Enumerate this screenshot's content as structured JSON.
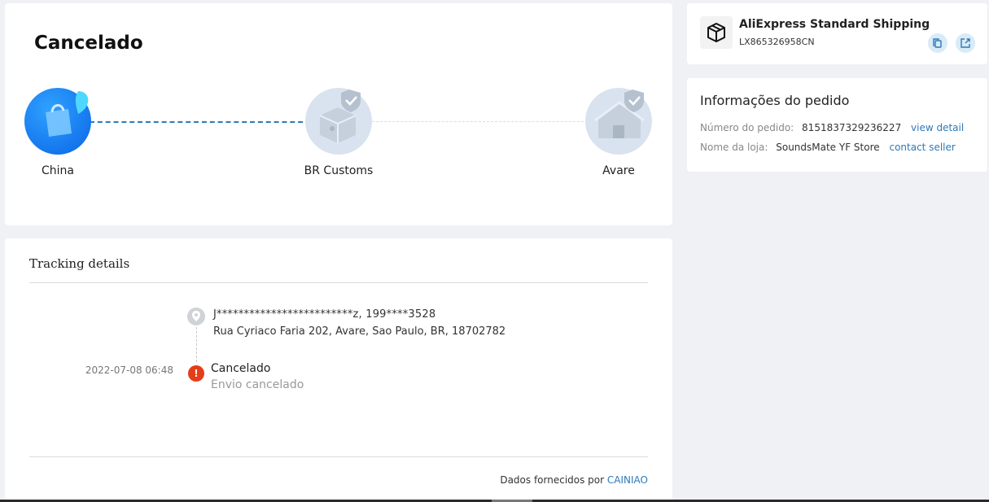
{
  "status": {
    "title": "Cancelado",
    "nodes": [
      {
        "label": "China",
        "state": "done",
        "icon": "shopping-bag-icon"
      },
      {
        "label": "BR Customs",
        "state": "pending",
        "icon": "customs-box-icon"
      },
      {
        "label": "Avare",
        "state": "pending",
        "icon": "house-icon"
      }
    ]
  },
  "tracking": {
    "title": "Tracking details",
    "recipient": "J*************************z,  199****3528",
    "address": "Rua Cyriaco Faria 202,  Avare,  Sao Paulo,  BR,  18702782",
    "event": {
      "time": "2022-07-08 06:48",
      "status": "Cancelado",
      "detail": "Envio cancelado"
    },
    "provider_prefix": "Dados fornecidos por",
    "provider_name": "CAINIAO"
  },
  "shipping": {
    "name": "AliExpress Standard Shipping",
    "number": "LX865326958CN"
  },
  "order": {
    "title": "Informações do pedido",
    "order_label": "Número do pedido:",
    "order_number": "8151837329236227",
    "order_link": "view detail",
    "store_label": "Nome da loja:",
    "store_name": "SoundsMate YF Store",
    "store_link": "contact seller"
  },
  "colors": {
    "accent": "#2f79b8",
    "alert": "#e43d18",
    "done_node": "#0a64e6",
    "pending_node": "#d9e3ef"
  }
}
